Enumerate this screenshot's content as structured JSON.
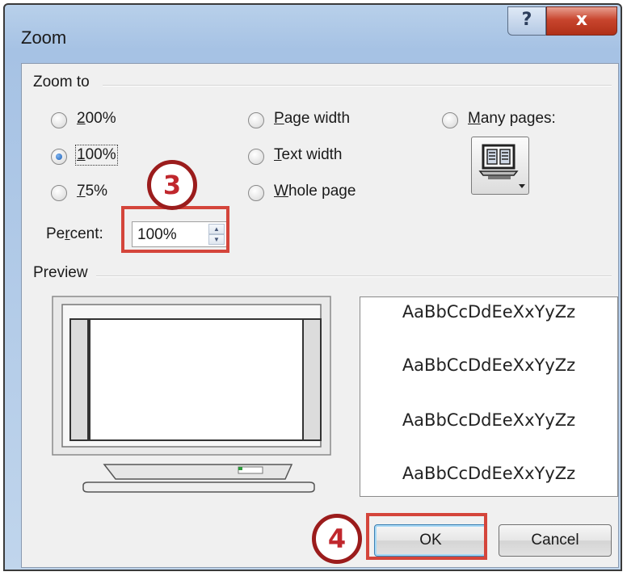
{
  "window": {
    "title": "Zoom",
    "help_label": "?",
    "close_label": "x"
  },
  "zoom_to": {
    "group_label": "Zoom to",
    "options": [
      {
        "label": "200%",
        "mnemonic": "2",
        "rest": "00%",
        "checked": false
      },
      {
        "label": "100%",
        "mnemonic": "1",
        "rest": "00%",
        "checked": true
      },
      {
        "label": "75%",
        "mnemonic": "7",
        "rest": "5%",
        "checked": false
      },
      {
        "label": "Page width",
        "mnemonic": "P",
        "rest": "age width",
        "checked": false
      },
      {
        "label": "Text width",
        "mnemonic": "T",
        "rest": "ext width",
        "checked": false
      },
      {
        "label": "Whole page",
        "mnemonic": "W",
        "rest": "hole page",
        "checked": false
      },
      {
        "label": "Many pages:",
        "mnemonic": "M",
        "rest": "any pages:",
        "checked": false
      }
    ],
    "percent": {
      "label_pre": "Pe",
      "label_mnemonic": "r",
      "label_post": "cent:",
      "value": "100%"
    }
  },
  "preview": {
    "group_label": "Preview",
    "sample_text": [
      "AaBbCcDdEeXxYyZz",
      "AaBbCcDdEeXxYyZz",
      "AaBbCcDdEeXxYyZz",
      "AaBbCcDdEeXxYyZz"
    ]
  },
  "buttons": {
    "ok": "OK",
    "cancel": "Cancel"
  },
  "annotations": {
    "step3": "3",
    "step4": "4"
  },
  "colors": {
    "highlight": "#d4453b",
    "badge_ring": "#9b1c1c",
    "badge_text": "#c0272d",
    "radio_selected": "#1c5fb8"
  },
  "icons": {
    "many_pages": "monitor-pages-icon",
    "spin_up": "spin-up-icon",
    "spin_down": "spin-down-icon"
  }
}
